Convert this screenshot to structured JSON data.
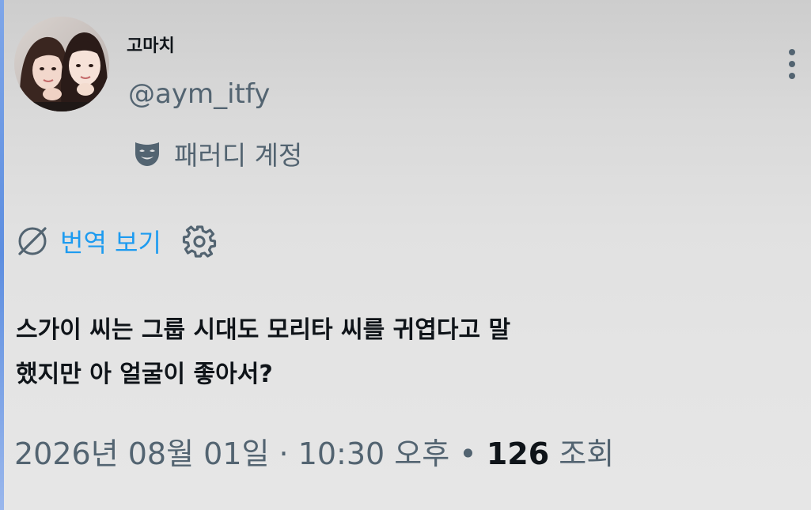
{
  "author": {
    "display_name": "고마치",
    "handle": "@aym_itfy",
    "parody_label": "패러디 계정",
    "parody_icon": "theater-mask-icon",
    "avatar_icon": "profile-photo"
  },
  "actions": {
    "more_icon": "more-vertical-icon"
  },
  "translation": {
    "label": "번역 보기",
    "icon": "translate-globe-icon",
    "settings_icon": "gear-icon"
  },
  "post": {
    "text_line1": "스가이 씨는 그룹 시대도 모리타 씨를 귀엽다고 말",
    "text_line2": "했지만 아 얼굴이 좋아서?"
  },
  "meta": {
    "datetime": "2026년 08월 01일 · 10:30 오후",
    "separator": "•",
    "views_count": "126",
    "views_label": "조회"
  },
  "colors": {
    "accent": "#1d9bf0",
    "secondary_text": "#536471",
    "primary_text": "#0f1419"
  }
}
